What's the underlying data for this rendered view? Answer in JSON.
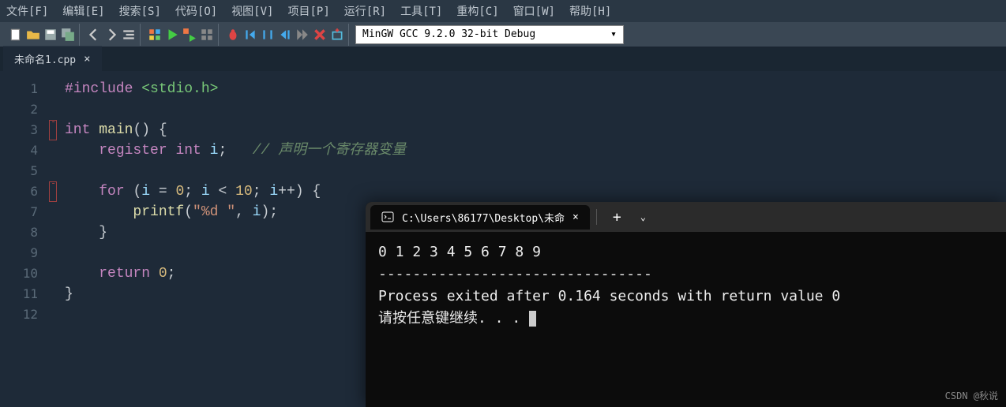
{
  "menu": [
    "文件[F]",
    "编辑[E]",
    "搜索[S]",
    "代码[O]",
    "视图[V]",
    "项目[P]",
    "运行[R]",
    "工具[T]",
    "重构[C]",
    "窗口[W]",
    "帮助[H]"
  ],
  "compiler": "MinGW GCC 9.2.0 32-bit Debug",
  "tab": {
    "title": "未命名1.cpp"
  },
  "gutter": [
    "1",
    "2",
    "3",
    "4",
    "5",
    "6",
    "7",
    "8",
    "9",
    "10",
    "11",
    "12"
  ],
  "code": {
    "l1a": "#include",
    "l1b": "<stdio.h>",
    "l3a": "int",
    "l3b": "main",
    "l3c": "() {",
    "l4a": "register",
    "l4b": "int",
    "l4c": "i",
    "l4d": ";",
    "l4e": "// 声明一个寄存器变量",
    "l6a": "for",
    "l6b": "(",
    "l6c": "i",
    "l6d": " = ",
    "l6e": "0",
    "l6f": "; ",
    "l6g": "i",
    "l6h": " < ",
    "l6i": "10",
    "l6j": "; ",
    "l6k": "i",
    "l6l": "++) {",
    "l7a": "printf",
    "l7b": "(",
    "l7c": "\"%d \"",
    "l7d": ", ",
    "l7e": "i",
    "l7f": ");",
    "l8": "}",
    "l10a": "return",
    "l10b": "0",
    "l10c": ";",
    "l11": "}"
  },
  "terminal": {
    "tabTitle": "C:\\Users\\86177\\Desktop\\未命",
    "out1": "0 1 2 3 4 5 6 7 8 9",
    "out2": "--------------------------------",
    "out3": "Process exited after 0.164 seconds with return value 0",
    "out4": "请按任意键继续. . . "
  },
  "watermark": "CSDN @秋说"
}
